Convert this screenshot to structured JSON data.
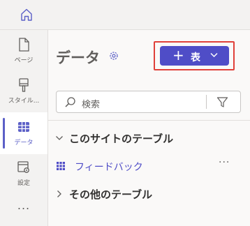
{
  "rail": {
    "items": [
      {
        "label": "ページ",
        "icon": "page-icon"
      },
      {
        "label": "スタイル...",
        "icon": "paintbrush-icon"
      },
      {
        "label": "データ",
        "icon": "table-icon",
        "active": true
      },
      {
        "label": "設定",
        "icon": "settings-icon"
      }
    ],
    "more": "..."
  },
  "panel": {
    "title": "データ",
    "add_button": {
      "label": "表"
    },
    "search": {
      "placeholder": "検索"
    },
    "sections": [
      {
        "label": "このサイトのテーブル",
        "expanded": true
      },
      {
        "label": "その他のテーブル",
        "expanded": false
      }
    ],
    "tables": [
      {
        "label": "フィードバック",
        "more": "···"
      }
    ]
  },
  "colors": {
    "accent": "#4f4dc7",
    "highlight_border": "#e0403a"
  }
}
